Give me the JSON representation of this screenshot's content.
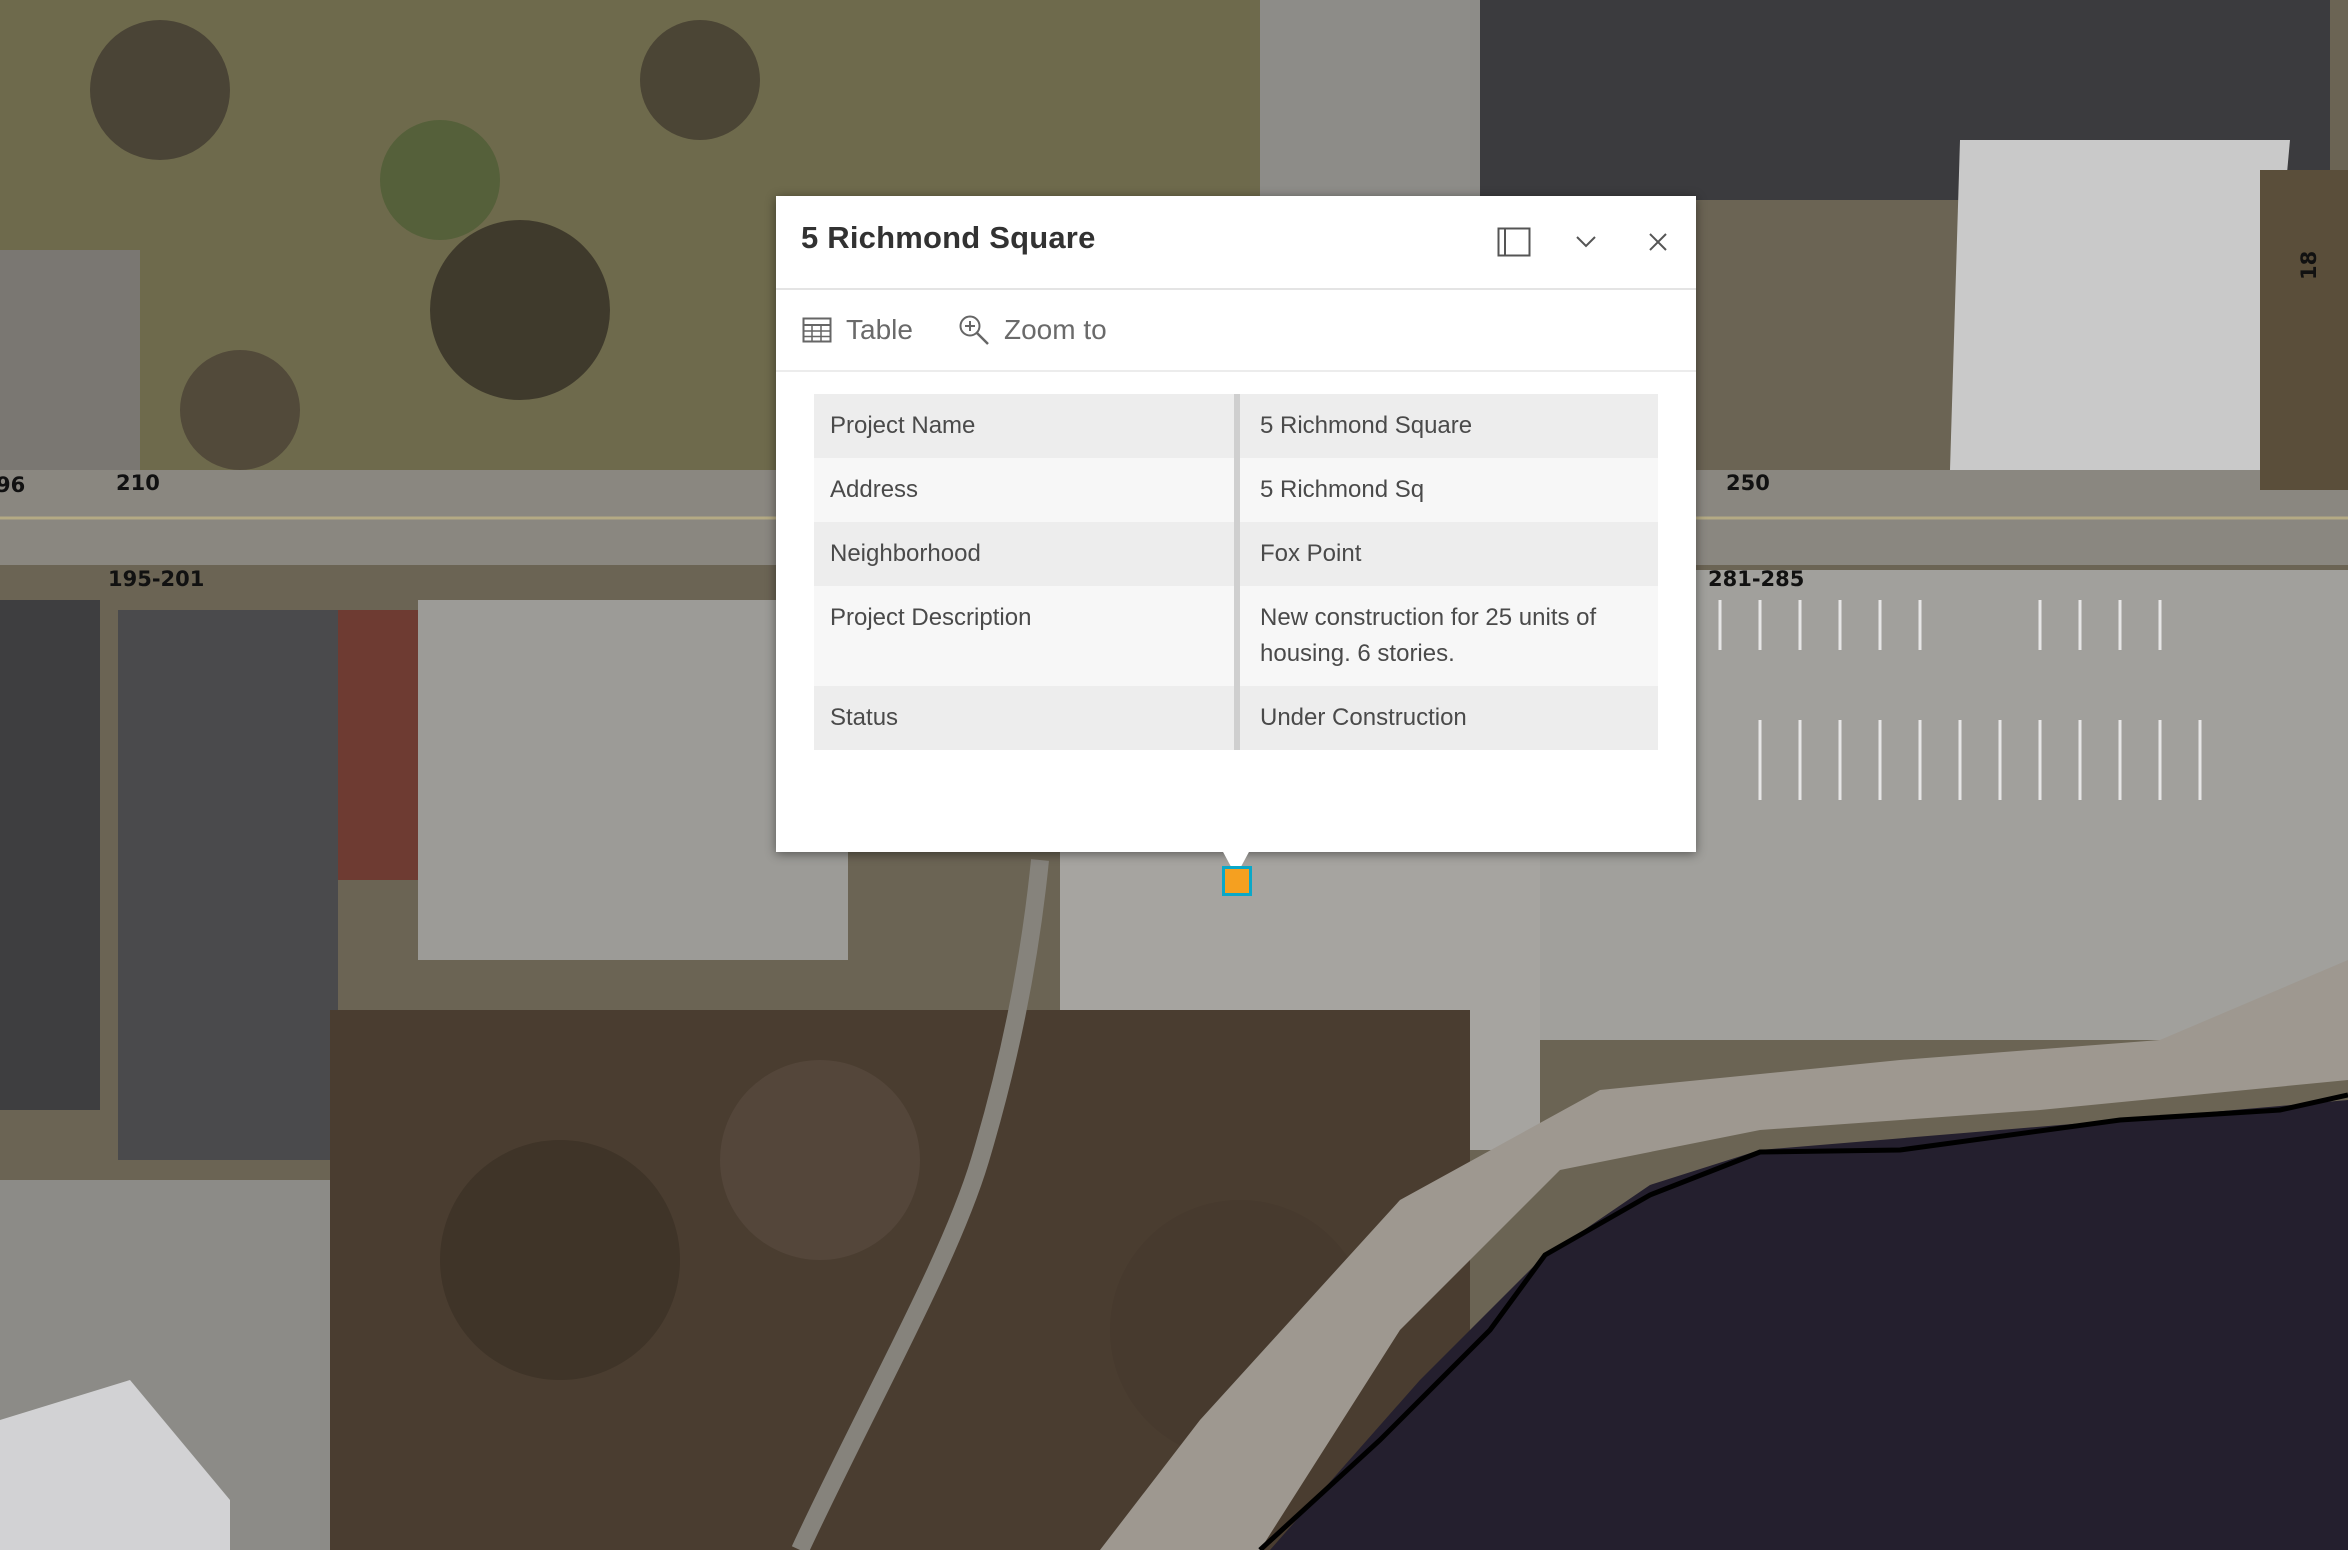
{
  "map": {
    "parcel_labels": [
      "96",
      "210",
      "195-201",
      "250",
      "281-285",
      "18"
    ],
    "colors": {
      "water": "#241f2e",
      "shoreline": "#000000",
      "trees": "#4a3d30",
      "parking": "#9a9a96",
      "roof_dark": "#3a3a3c",
      "roof_light": "#c8c8c8",
      "grass": "#6e6a4c"
    }
  },
  "popup": {
    "title": "5 Richmond Square",
    "actions": {
      "table_label": "Table",
      "zoom_label": "Zoom to"
    },
    "icons": {
      "dock": "dock-icon",
      "collapse": "chevron-down-icon",
      "close": "close-icon",
      "table": "table-icon",
      "zoom": "zoom-in-icon"
    },
    "fields": [
      {
        "key": "Project Name",
        "value": "5 Richmond Square"
      },
      {
        "key": "Address",
        "value": "5 Richmond Sq"
      },
      {
        "key": "Neighborhood",
        "value": "Fox Point"
      },
      {
        "key": "Project Description",
        "value": "New construction for 25 units of housing. 6 stories."
      },
      {
        "key": "Status",
        "value": "Under Construction"
      }
    ]
  },
  "feature_marker": {
    "fill": "#f5a020",
    "outline": "#0aa8c8"
  }
}
